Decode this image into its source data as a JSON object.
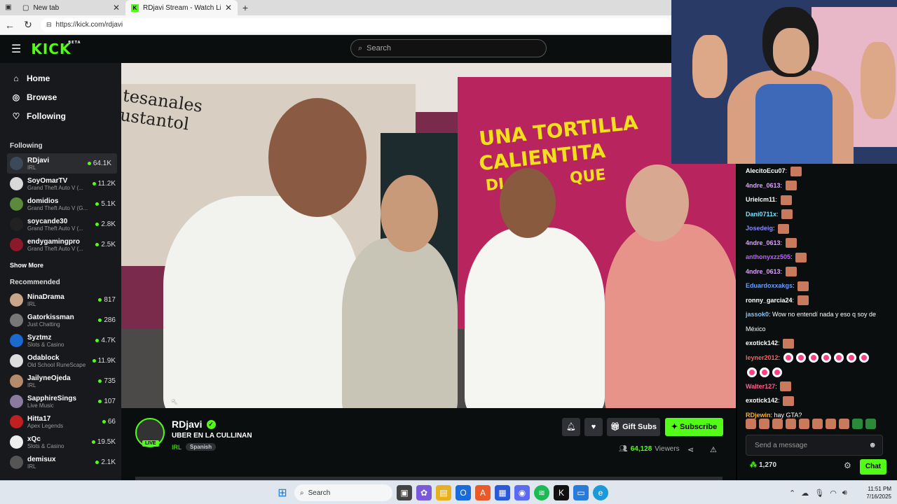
{
  "browser": {
    "tabs": [
      {
        "title": "New tab",
        "active": false
      },
      {
        "title": "RDjavi Stream - Watch Live on Kick",
        "active": true
      }
    ],
    "url": "https://kick.com/rdjavi"
  },
  "header": {
    "logo": "KICK",
    "logo_badge": "BETA",
    "search_placeholder": "Search"
  },
  "sidebar": {
    "nav": [
      {
        "label": "Home",
        "icon": "home-icon"
      },
      {
        "label": "Browse",
        "icon": "compass-icon"
      },
      {
        "label": "Following",
        "icon": "heart-icon"
      }
    ],
    "following_title": "Following",
    "following": [
      {
        "name": "RDjavi",
        "category": "IRL",
        "viewers": "64.1K",
        "color": "#3a4a5a"
      },
      {
        "name": "SoyOmarTV",
        "category": "Grand Theft Auto V (...",
        "viewers": "11.2K",
        "color": "#d9d9d9"
      },
      {
        "name": "domidios",
        "category": "Grand Theft Auto V (G...",
        "viewers": "5.1K",
        "color": "#5a8a3a"
      },
      {
        "name": "soycande30",
        "category": "Grand Theft Auto V (...",
        "viewers": "2.8K",
        "color": "#222"
      },
      {
        "name": "endygamingpro",
        "category": "Grand Theft Auto V (...",
        "viewers": "2.5K",
        "color": "#8a1a2a"
      }
    ],
    "show_more": "Show More",
    "recommended_title": "Recommended",
    "recommended": [
      {
        "name": "NinaDrama",
        "category": "IRL",
        "viewers": "817",
        "color": "#c9a68a"
      },
      {
        "name": "Gatorkissman",
        "category": "Just Chatting",
        "viewers": "286",
        "color": "#777"
      },
      {
        "name": "Syztmz",
        "category": "Slots & Casino",
        "viewers": "4.7K",
        "color": "#1a6ad0"
      },
      {
        "name": "Odablock",
        "category": "Old School RuneScape",
        "viewers": "11.9K",
        "color": "#ddd"
      },
      {
        "name": "JailyneOjeda",
        "category": "IRL",
        "viewers": "735",
        "color": "#b58a6a"
      },
      {
        "name": "SapphireSings",
        "category": "Live Music",
        "viewers": "107",
        "color": "#8a7aa0"
      },
      {
        "name": "Hitta17",
        "category": "Apex Legends",
        "viewers": "66",
        "color": "#c02020"
      },
      {
        "name": "xQc",
        "category": "Slots & Casino",
        "viewers": "19.5K",
        "color": "#eee"
      },
      {
        "name": "demisux",
        "category": "IRL",
        "viewers": "2.1K",
        "color": "#555"
      }
    ]
  },
  "video": {
    "sign_yellow": [
      "UNA TORTILLA",
      "CALIENTITA"
    ],
    "sign_partial": [
      "DI",
      "QUE"
    ],
    "sign_left": [
      "tesanales",
      "ustantol"
    ]
  },
  "channel": {
    "name": "RDjavi",
    "live_label": "LIVE",
    "stream_title": "UBER EN LA CULLINAN",
    "category": "IRL",
    "tag": "Spanish",
    "gift_label": "Gift Subs",
    "subscribe_label": "Subscribe",
    "viewers_count": "64,128",
    "viewers_label": "Viewers"
  },
  "chat": {
    "messages": [
      {
        "user": "AlecitoEcu07",
        "color": "#ffffff",
        "text": "",
        "emotes": 1
      },
      {
        "user": "4ndre_0613",
        "color": "#e0a0ff",
        "text": "",
        "emotes": 1
      },
      {
        "user": "Urielcm11",
        "color": "#ffffff",
        "text": "",
        "emotes": 1
      },
      {
        "user": "Dani0711x",
        "color": "#7be0ff",
        "text": "",
        "emotes": 1
      },
      {
        "user": "Josedeig",
        "color": "#8a8aff",
        "text": "",
        "emotes": 1
      },
      {
        "user": "4ndre_0613",
        "color": "#e0a0ff",
        "text": "",
        "emotes": 1
      },
      {
        "user": "anthonyxzz505",
        "color": "#c060ff",
        "text": "",
        "emotes": 1
      },
      {
        "user": "4ndre_0613",
        "color": "#e0a0ff",
        "text": "",
        "emotes": 1
      },
      {
        "user": "Eduardoxxakgs",
        "color": "#66a0ff",
        "text": "",
        "emotes": 1
      },
      {
        "user": "ronny_garcia24",
        "color": "#ffffff",
        "text": "",
        "emotes": 1
      },
      {
        "user": "jassok0",
        "color": "#7bc6ff",
        "text": "Wow no entendí nada y eso q soy de",
        "emotes": 0
      },
      {
        "user": "",
        "color": "#ffffff",
        "text": "México",
        "emotes": 0
      },
      {
        "user": "exotick142",
        "color": "#ffffff",
        "text": "",
        "emotes": 1
      },
      {
        "user": "leyner2012",
        "color": "#ff5f5f",
        "text": "",
        "hearts": 7
      },
      {
        "user": "",
        "color": "#ffffff",
        "text": "",
        "hearts": 3
      },
      {
        "user": "Walter127",
        "color": "#ff5f8f",
        "text": "",
        "emotes": 1
      },
      {
        "user": "exotick142",
        "color": "#ffffff",
        "text": "",
        "emotes": 1
      },
      {
        "user": "RDjewin",
        "color": "#ffb020",
        "text": "hay GTA?",
        "emotes": 0
      }
    ],
    "input_placeholder": "Send a message",
    "points": "1,270",
    "chat_button": "Chat"
  },
  "taskbar": {
    "search_placeholder": "Search",
    "time": "11:51 PM",
    "date": "7/16/2025"
  }
}
